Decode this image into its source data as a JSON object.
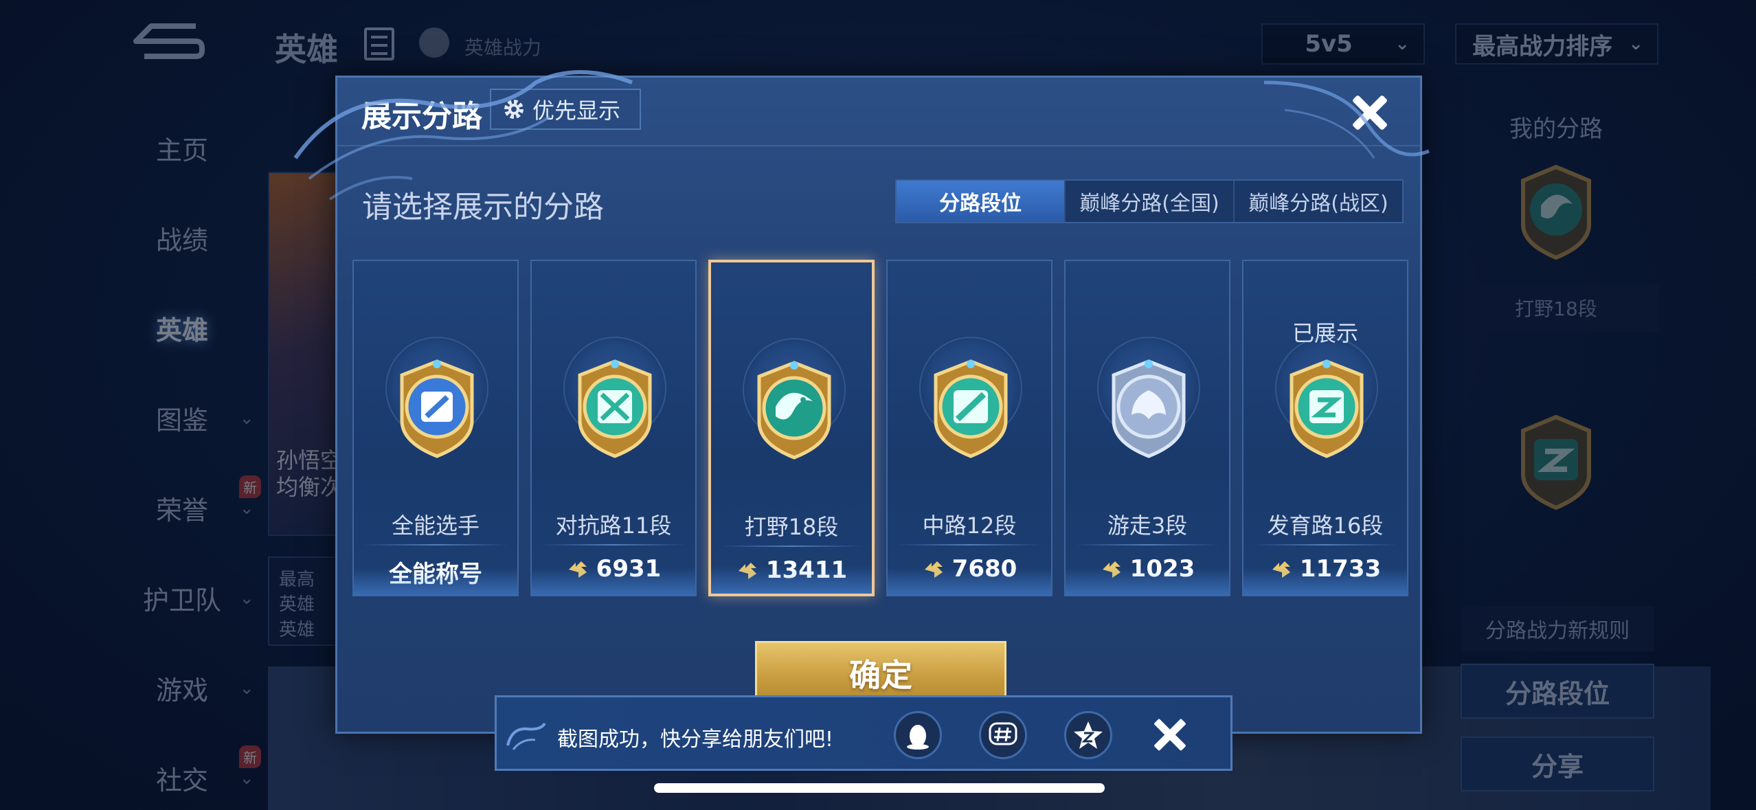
{
  "background": {
    "page_title": "英雄",
    "power_label": "英雄战力",
    "mode_select": "5v5",
    "sort_select": "最高战力排序",
    "sidebar": [
      {
        "label": "主页",
        "chevron": false,
        "badge": ""
      },
      {
        "label": "战绩",
        "chevron": false,
        "badge": ""
      },
      {
        "label": "英雄",
        "chevron": false,
        "badge": "",
        "active": true
      },
      {
        "label": "图鉴",
        "chevron": true,
        "badge": ""
      },
      {
        "label": "荣誉",
        "chevron": true,
        "badge": "新"
      },
      {
        "label": "护卫队",
        "chevron": true,
        "badge": ""
      },
      {
        "label": "游戏",
        "chevron": true,
        "badge": ""
      },
      {
        "label": "社交",
        "chevron": true,
        "badge": "新"
      }
    ],
    "hero_card": {
      "name_line1": "孙悟空",
      "name_line2": "均衡次"
    },
    "info_card": {
      "line1": "最高",
      "line2": "英雄",
      "line3": "英雄"
    },
    "right_panel": {
      "title": "我的分路",
      "label_box": "打野18段",
      "rule_link": "分路战力新规则",
      "route_button": "分路段位",
      "share_button": "分享"
    }
  },
  "modal": {
    "title": "展示分路",
    "priority_button": "优先显示",
    "subtitle": "请选择展示的分路",
    "tabs": [
      {
        "label": "分路段位",
        "active": true
      },
      {
        "label": "巅峰分路(全国)",
        "active": false
      },
      {
        "label": "巅峰分路(战区)",
        "active": false
      }
    ],
    "cards": [
      {
        "name": "全能选手",
        "value": "全能称号",
        "has_coin": false,
        "selected": false,
        "shown_label": "",
        "emblem": "all-round-emblem-icon",
        "emblem_color": "#3a7ad8"
      },
      {
        "name": "对抗路11段",
        "value": "6931",
        "has_coin": true,
        "selected": false,
        "shown_label": "",
        "emblem": "clash-lane-emblem-icon",
        "emblem_color": "#2bb59c"
      },
      {
        "name": "打野18段",
        "value": "13411",
        "has_coin": true,
        "selected": true,
        "shown_label": "",
        "emblem": "jungle-emblem-icon",
        "emblem_color": "#1f9e8a"
      },
      {
        "name": "中路12段",
        "value": "7680",
        "has_coin": true,
        "selected": false,
        "shown_label": "",
        "emblem": "mid-lane-emblem-icon",
        "emblem_color": "#2bb59c"
      },
      {
        "name": "游走3段",
        "value": "1023",
        "has_coin": true,
        "selected": false,
        "shown_label": "",
        "emblem": "roam-emblem-icon",
        "emblem_color": "#9fb3d6"
      },
      {
        "name": "发育路16段",
        "value": "11733",
        "has_coin": true,
        "selected": false,
        "shown_label": "已展示",
        "emblem": "farm-lane-emblem-icon",
        "emblem_color": "#2bb59c"
      }
    ],
    "confirm_button": "确定"
  },
  "toast": {
    "message": "截图成功，快分享给朋友们吧!",
    "icons": [
      "qq-share-icon",
      "topic-share-icon",
      "qzone-share-icon"
    ]
  },
  "colors": {
    "accent_gold": "#e7c46b",
    "selected_border": "#f0c894",
    "modal_bg": "#234376",
    "active_tab": "#3f7ad0"
  }
}
